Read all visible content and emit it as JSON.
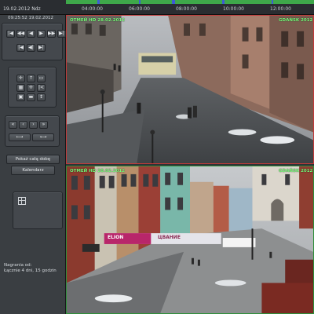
{
  "timeline": {
    "date": "19.02.2012 Ndz",
    "ticks": [
      "04:00:00",
      "06:00:00",
      "08:00:00",
      "10:00:00",
      "12:00:00"
    ],
    "colors": {
      "recorded": "#3ea84a",
      "gap": "#3d5bd6",
      "background": "#2a2d31"
    }
  },
  "sidebar": {
    "clock": "09:25:52 19.02.2012",
    "playback_buttons": {
      "row1": [
        "|◀",
        "◀◀",
        "◀",
        "▶",
        "▶▶",
        "▶|"
      ],
      "row2": [
        "|◀",
        "◀|",
        "▶|"
      ]
    },
    "ptz_buttons": {
      "row1": [
        "✛",
        "↑",
        "▭"
      ],
      "row2": [
        "▦",
        "✛",
        "|<"
      ],
      "row3": [
        "▣",
        "▬",
        "↕"
      ]
    },
    "nav_buttons": {
      "row1": [
        "«",
        "‹",
        "›",
        "»"
      ],
      "row2": [
        "⟼",
        "⟷"
      ]
    },
    "show_full_day": "Pokaż całą dobę",
    "calendar": "Kalendarz",
    "recording_label": "Nagrania od:",
    "recording_value": "Łącznie 4 dni, 15 godzin"
  },
  "cameras": [
    {
      "name": "ОТМЕЙ HD 28.02.2012",
      "badge": "GDAŃSK 2012",
      "accent": "#c23a3a"
    },
    {
      "name": "ОТМЕЙ HD 28.02.2012",
      "badge": "GDAŃSK 2012",
      "banner_left": "ELION",
      "banner_right": "ЦВАНИЕ",
      "accent": "#2f8f3a"
    }
  ]
}
